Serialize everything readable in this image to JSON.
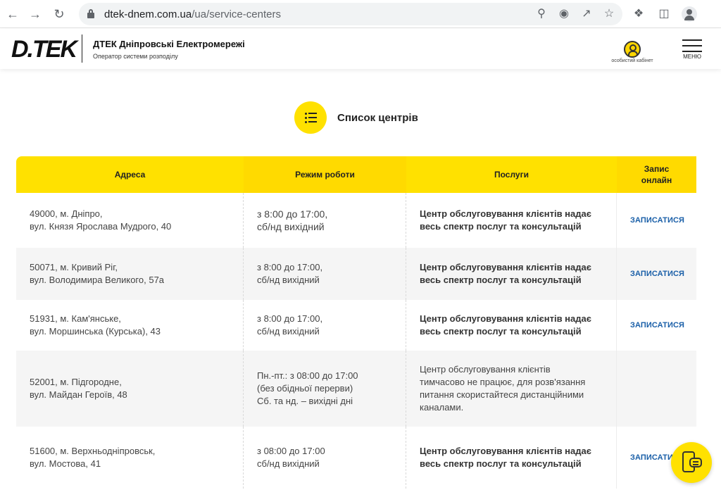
{
  "browser": {
    "url_host": "dtek-dnem.com.ua",
    "url_path": "/ua/service-centers",
    "icons": [
      "back-icon",
      "forward-icon",
      "reload-icon",
      "lock-icon",
      "zoom-icon",
      "eye-off-icon",
      "share-icon",
      "star-icon",
      "puzzle-icon",
      "sidepanel-icon",
      "profile-icon"
    ]
  },
  "header": {
    "logo": "D.TEK",
    "title": "ДТЕК Дніпровські Електромережі",
    "subtitle": "Оператор системи розподілу",
    "cabinet_label": "особистий кабінет",
    "menu_label": "МЕНЮ"
  },
  "section": {
    "title": "Список центрів"
  },
  "table": {
    "headers": [
      "Адреса",
      "Режим роботи",
      "Послуги",
      "Запис онлайн"
    ],
    "rows": [
      {
        "address1": "49000, м. Дніпро,",
        "address2": "вул. Князя Ярослава Мудрого, 40",
        "hours": [
          "з 8:00 до 17:00,",
          "сб/нд вихідний"
        ],
        "services": [
          "Центр обслуговування клієнтів надає",
          "весь спектр послуг та консультацій"
        ],
        "services_bold": true,
        "book": "ЗАПИСАТИСЯ"
      },
      {
        "address1": "50071, м. Кривий Ріг,",
        "address2": "вул. Володимира Великого, 57а",
        "hours": [
          "з 8:00 до 17:00,",
          "сб/нд вихідний"
        ],
        "services": [
          "Центр обслуговування клієнтів надає",
          "весь спектр послуг та консультацій"
        ],
        "services_bold": true,
        "book": "ЗАПИСАТИСЯ"
      },
      {
        "address1": "51931, м. Кам'янське,",
        "address2": "вул. Моршинська (Курська), 43",
        "hours": [
          "з 8:00 до 17:00,",
          "сб/нд вихідний"
        ],
        "services": [
          "Центр обслуговування клієнтів надає",
          "весь спектр послуг та консультацій"
        ],
        "services_bold": true,
        "book": "ЗАПИСАТИСЯ"
      },
      {
        "address1": "52001, м. Підгородне,",
        "address2": "вул. Майдан Героїв, 48",
        "hours": [
          "Пн.-пт.: з 08:00 до 17:00",
          "(без обідньої перерви)",
          "Сб. та нд. – вихідні дні"
        ],
        "services": [
          "Центр обслуговування клієнтів",
          "тимчасово не працює, для розв'язання",
          "питання скористайтеся дистанційними",
          "каналами."
        ],
        "services_bold": false,
        "book": ""
      },
      {
        "address1": "51600, м. Верхньодніпровськ,",
        "address2": "вул. Мостова, 41",
        "hours": [
          "з 08:00 до 17:00",
          "сб/нд вихідний"
        ],
        "services": [
          "Центр обслуговування клієнтів надає",
          "весь спектр послуг та консультацій"
        ],
        "services_bold": true,
        "book": "ЗАПИСАТИ"
      }
    ]
  },
  "colors": {
    "accent_yellow": "#ffe100",
    "link_blue": "#1a5fa8"
  },
  "fab_icon": "chat-phone-icon"
}
